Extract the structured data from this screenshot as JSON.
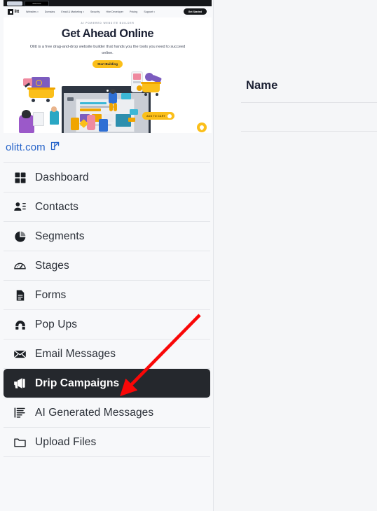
{
  "site_preview": {
    "browser": {
      "inactive_tab": "",
      "active_tab_label": "olitt.com"
    },
    "nav": {
      "logo_text": "litt",
      "menu": [
        {
          "label": "Websites",
          "caret": "▾"
        },
        {
          "label": "Domains",
          "caret": ""
        },
        {
          "label": "Email & Marketing",
          "caret": "▾"
        },
        {
          "label": "Security",
          "caret": ""
        },
        {
          "label": "Hire Developer",
          "caret": ""
        },
        {
          "label": "Pricing",
          "caret": ""
        },
        {
          "label": "Support",
          "caret": "▾"
        }
      ],
      "cta_label": "Get Started"
    },
    "hero": {
      "eyebrow": "AI POWERED WEBSITE BUILDER",
      "title": "Get Ahead Online",
      "subtitle": "Olitt is a free drag-and-drop website builder that hands you the tools you need to succeed online.",
      "button_label": "Start Building",
      "badge_label": "ADD TO CART"
    }
  },
  "domain": {
    "label": "olitt.com",
    "external_icon": "external-link-icon"
  },
  "sidebar": {
    "items": [
      {
        "label": "Dashboard",
        "icon": "grid-icon",
        "active": false
      },
      {
        "label": "Contacts",
        "icon": "contacts-icon",
        "active": false
      },
      {
        "label": "Segments",
        "icon": "pie-chart-icon",
        "active": false
      },
      {
        "label": "Stages",
        "icon": "gauge-icon",
        "active": false
      },
      {
        "label": "Forms",
        "icon": "document-icon",
        "active": false
      },
      {
        "label": "Pop Ups",
        "icon": "magnet-icon",
        "active": false
      },
      {
        "label": "Email Messages",
        "icon": "envelope-icon",
        "active": false
      },
      {
        "label": "Drip Campaigns",
        "icon": "megaphone-icon",
        "active": true
      },
      {
        "label": "AI Generated Messages",
        "icon": "ai-lines-icon",
        "active": false
      },
      {
        "label": "Upload Files",
        "icon": "folder-icon",
        "active": false
      }
    ]
  },
  "main": {
    "table": {
      "columns": [
        "Name"
      ],
      "rows": []
    }
  },
  "annotation": {
    "arrow_color": "#f90707",
    "points_to": "Drip Campaigns"
  },
  "colors": {
    "accent_yellow": "#fbbf1a",
    "link_blue": "#2563c9",
    "active_dark": "#25282d",
    "page_bg": "#f5f6f8",
    "sidebar_bg": "#f7f8fa"
  }
}
